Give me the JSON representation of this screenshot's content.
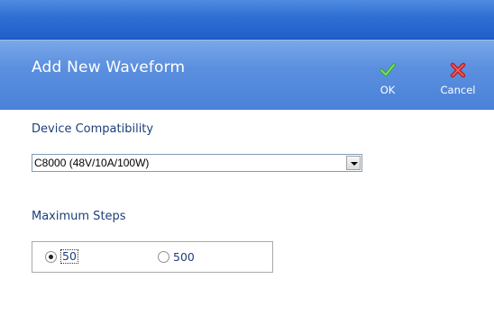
{
  "dialog": {
    "title": "Add New Waveform",
    "ok_label": "OK",
    "cancel_label": "Cancel",
    "icons": {
      "ok": "checkmark-icon",
      "cancel": "x-icon"
    },
    "colors": {
      "header": "#5b8fdf",
      "title_bar": "#2f6fd4",
      "label_text": "#1c3f7a"
    }
  },
  "device": {
    "label": "Device Compatibility",
    "selected": "C8000 (48V/10A/100W)"
  },
  "steps": {
    "label": "Maximum Steps",
    "options": [
      {
        "label": "50",
        "checked": true
      },
      {
        "label": "500",
        "checked": false
      }
    ]
  }
}
